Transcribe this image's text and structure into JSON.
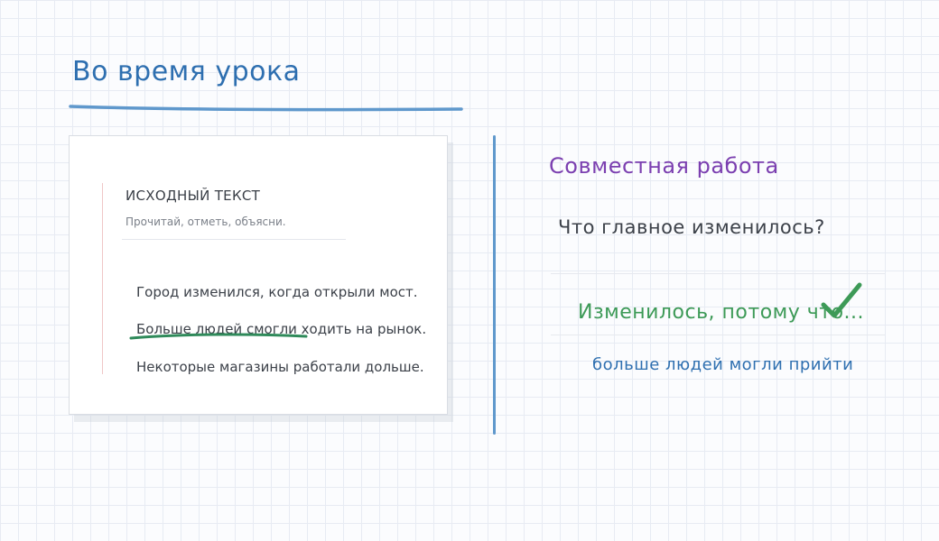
{
  "page": {
    "title": "Во время урока"
  },
  "card": {
    "heading": "ИСХОДНЫЙ ТЕКСТ",
    "subheading": "Прочитай, отметь, объясни.",
    "lines": [
      "Город изменился, когда открыли мост.",
      "Больше людей смогли ходить на рынок.",
      "Некоторые магазины работали дольше."
    ]
  },
  "collab": {
    "title": "Совместная работа",
    "question": "Что главное изменилось?",
    "answer": "Изменилось, потому что...",
    "answer_continuation": "больше людей могли прийти"
  },
  "colors": {
    "title_blue": "#2e6fb0",
    "purple": "#7b3fb0",
    "green": "#3d9a57",
    "divider_blue": "#5f98cc"
  },
  "icons": {
    "check": "checkmark-icon"
  }
}
